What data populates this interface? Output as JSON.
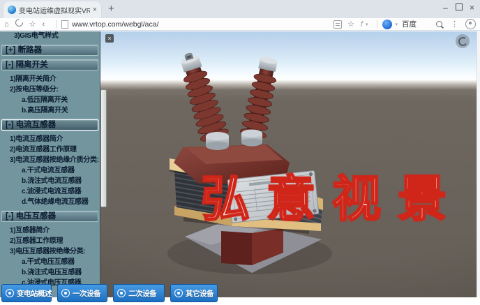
{
  "browser": {
    "tab_title": "变电站运维虚拟现实VR",
    "tab_close": "×",
    "new_tab": "+",
    "window": {
      "minimize": "–",
      "close": "×"
    },
    "toolbar": {
      "url": "www.vrtop.com/webgl/aca/",
      "search_engine": "百度",
      "glyphs": {
        "home": "⌂",
        "star": "☆",
        "back": "‹",
        "bookmark_star": "☆",
        "flash": "f",
        "caret": "▾",
        "logo_caret": "▾",
        "menu_dots": "⋮"
      }
    }
  },
  "sidebar": {
    "items": [
      {
        "label": "3)GIS电气样式",
        "type": "num2"
      },
      {
        "label": "[+] 断路器",
        "type": "header"
      },
      {
        "label": "[-] 隔离开关",
        "type": "header"
      },
      {
        "label": "1)隔离开关简介",
        "type": "num"
      },
      {
        "label": "2)按电压等级分:",
        "type": "num"
      },
      {
        "label": "a.低压隔离开关",
        "type": "sub"
      },
      {
        "label": "b.高压隔离开关",
        "type": "sub"
      },
      {
        "label": "[-] 电流互感器",
        "type": "header",
        "selected": true
      },
      {
        "label": "1)电流互感器简介",
        "type": "num"
      },
      {
        "label": "2)电流互感器工作原理",
        "type": "num"
      },
      {
        "label": "3)电流互感器按绝缘介质分类:",
        "type": "num"
      },
      {
        "label": "a.干式电流互感器",
        "type": "sub"
      },
      {
        "label": "b.浇注式电流互感器",
        "type": "sub"
      },
      {
        "label": "c.油浸式电流互感器",
        "type": "sub"
      },
      {
        "label": "d.气体绝缘电流互感器",
        "type": "sub"
      },
      {
        "label": "[-] 电压互感器",
        "type": "header"
      },
      {
        "label": "1)互感器简介",
        "type": "num"
      },
      {
        "label": "2)互感器工作原理",
        "type": "num"
      },
      {
        "label": "3)电压互感器按绝缘分类:",
        "type": "num"
      },
      {
        "label": "a.干式电压互感器",
        "type": "sub"
      },
      {
        "label": "b.浇注式电压互感器",
        "type": "sub"
      },
      {
        "label": "c.油浸式电压互感器",
        "type": "sub"
      }
    ]
  },
  "viewport": {
    "close_glyph": "×",
    "watermark": "弘意视景"
  },
  "bottom_bar": {
    "buttons": [
      {
        "label": "变电站概述"
      },
      {
        "label": "一次设备"
      },
      {
        "label": "二次设备"
      },
      {
        "label": "其它设备"
      }
    ]
  },
  "colors": {
    "sidebar_bg": "#72959E",
    "header_bar": "#54727D",
    "accent_blue": "#2B7FD4",
    "watermark_red": "#D0261A",
    "sky_top": "#B5D0EA",
    "ground": "#6B645D"
  }
}
